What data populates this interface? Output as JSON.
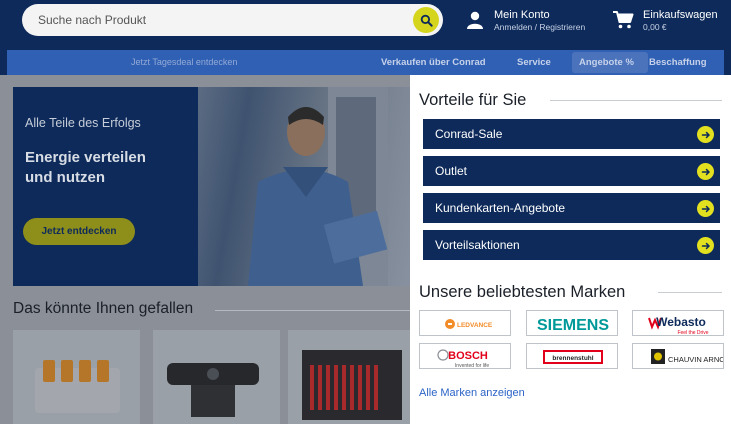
{
  "header": {
    "search_placeholder": "Suche nach Produkt",
    "account_title": "Mein Konto",
    "account_sub": "Anmelden / Registrieren",
    "cart_title": "Einkaufswagen",
    "cart_total": "0,00 €"
  },
  "nav": {
    "deal_text": "Jetzt Tagesdeal entdecken",
    "items": [
      "Verkaufen über Conrad",
      "Service",
      "Angebote %",
      "Beschaffung"
    ]
  },
  "hero": {
    "subtitle": "Alle Teile des Erfolgs",
    "title": "Energie verteilen und nutzen",
    "cta": "Jetzt entdecken"
  },
  "recommendations": {
    "title": "Das könnte Ihnen gefallen"
  },
  "panel": {
    "advantages_title": "Vorteile für Sie",
    "items": [
      "Conrad-Sale",
      "Outlet",
      "Kundenkarten-Angebote",
      "Vorteilsaktionen"
    ],
    "brands_title": "Unsere beliebtesten Marken",
    "brands": [
      "LEDVANCE",
      "SIEMENS",
      "Webasto",
      "BOSCH",
      "brennenstuhl",
      "CHAUVIN ARNOUX"
    ],
    "brand_taglines": {
      "webasto": "Feel the Drive",
      "bosch": "Invented for life"
    },
    "all_brands_link": "Alle Marken anzeigen"
  },
  "colors": {
    "brand_navy": "#0d2a5a",
    "accent_yellow": "#e2e01f",
    "nav_blue": "#2f60b4",
    "link_blue": "#2b63c6"
  }
}
